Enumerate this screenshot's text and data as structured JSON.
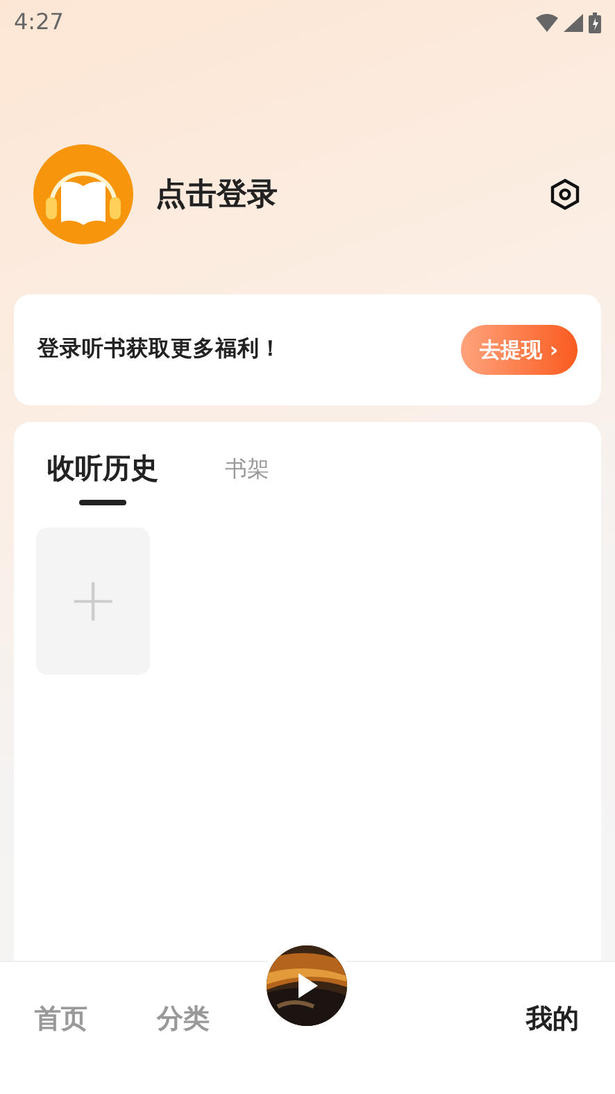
{
  "status_bar": {
    "time": "4:27"
  },
  "profile": {
    "login_label": "点击登录"
  },
  "promo": {
    "text": "登录听书获取更多福利！",
    "button": "去提现",
    "button_arrow": "›"
  },
  "library_tabs": [
    {
      "label": "收听历史",
      "selected": true
    },
    {
      "label": "书架",
      "selected": false
    }
  ],
  "history": {
    "add_tile": "+"
  },
  "bottom_nav": [
    {
      "kind": "tab",
      "label": "首页",
      "selected": false
    },
    {
      "kind": "tab",
      "label": "分类",
      "selected": false
    },
    {
      "kind": "player"
    },
    {
      "kind": "blank"
    },
    {
      "kind": "tab",
      "label": "我的",
      "selected": true
    }
  ]
}
